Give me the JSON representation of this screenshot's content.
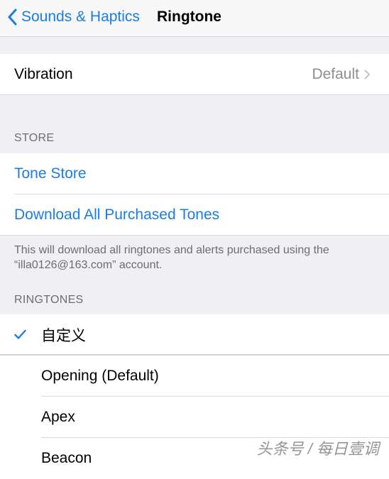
{
  "navbar": {
    "back_label": "Sounds & Haptics",
    "title": "Ringtone"
  },
  "vibration": {
    "label": "Vibration",
    "value": "Default"
  },
  "store": {
    "header": "STORE",
    "tone_store_label": "Tone Store",
    "download_label": "Download All Purchased Tones",
    "footer_note": "This will download all ringtones and alerts purchased using the “illa0126@163.com” account."
  },
  "ringtones": {
    "header": "RINGTONES",
    "items": [
      {
        "label": "自定义",
        "selected": true
      },
      {
        "label": "Opening (Default)",
        "selected": false
      },
      {
        "label": "Apex",
        "selected": false
      },
      {
        "label": "Beacon",
        "selected": false
      }
    ]
  },
  "watermark": "头条号 / 每日壹调",
  "colors": {
    "accent": "#1a7de0",
    "background": "#efeff4",
    "secondary_text": "#8e8e93"
  }
}
